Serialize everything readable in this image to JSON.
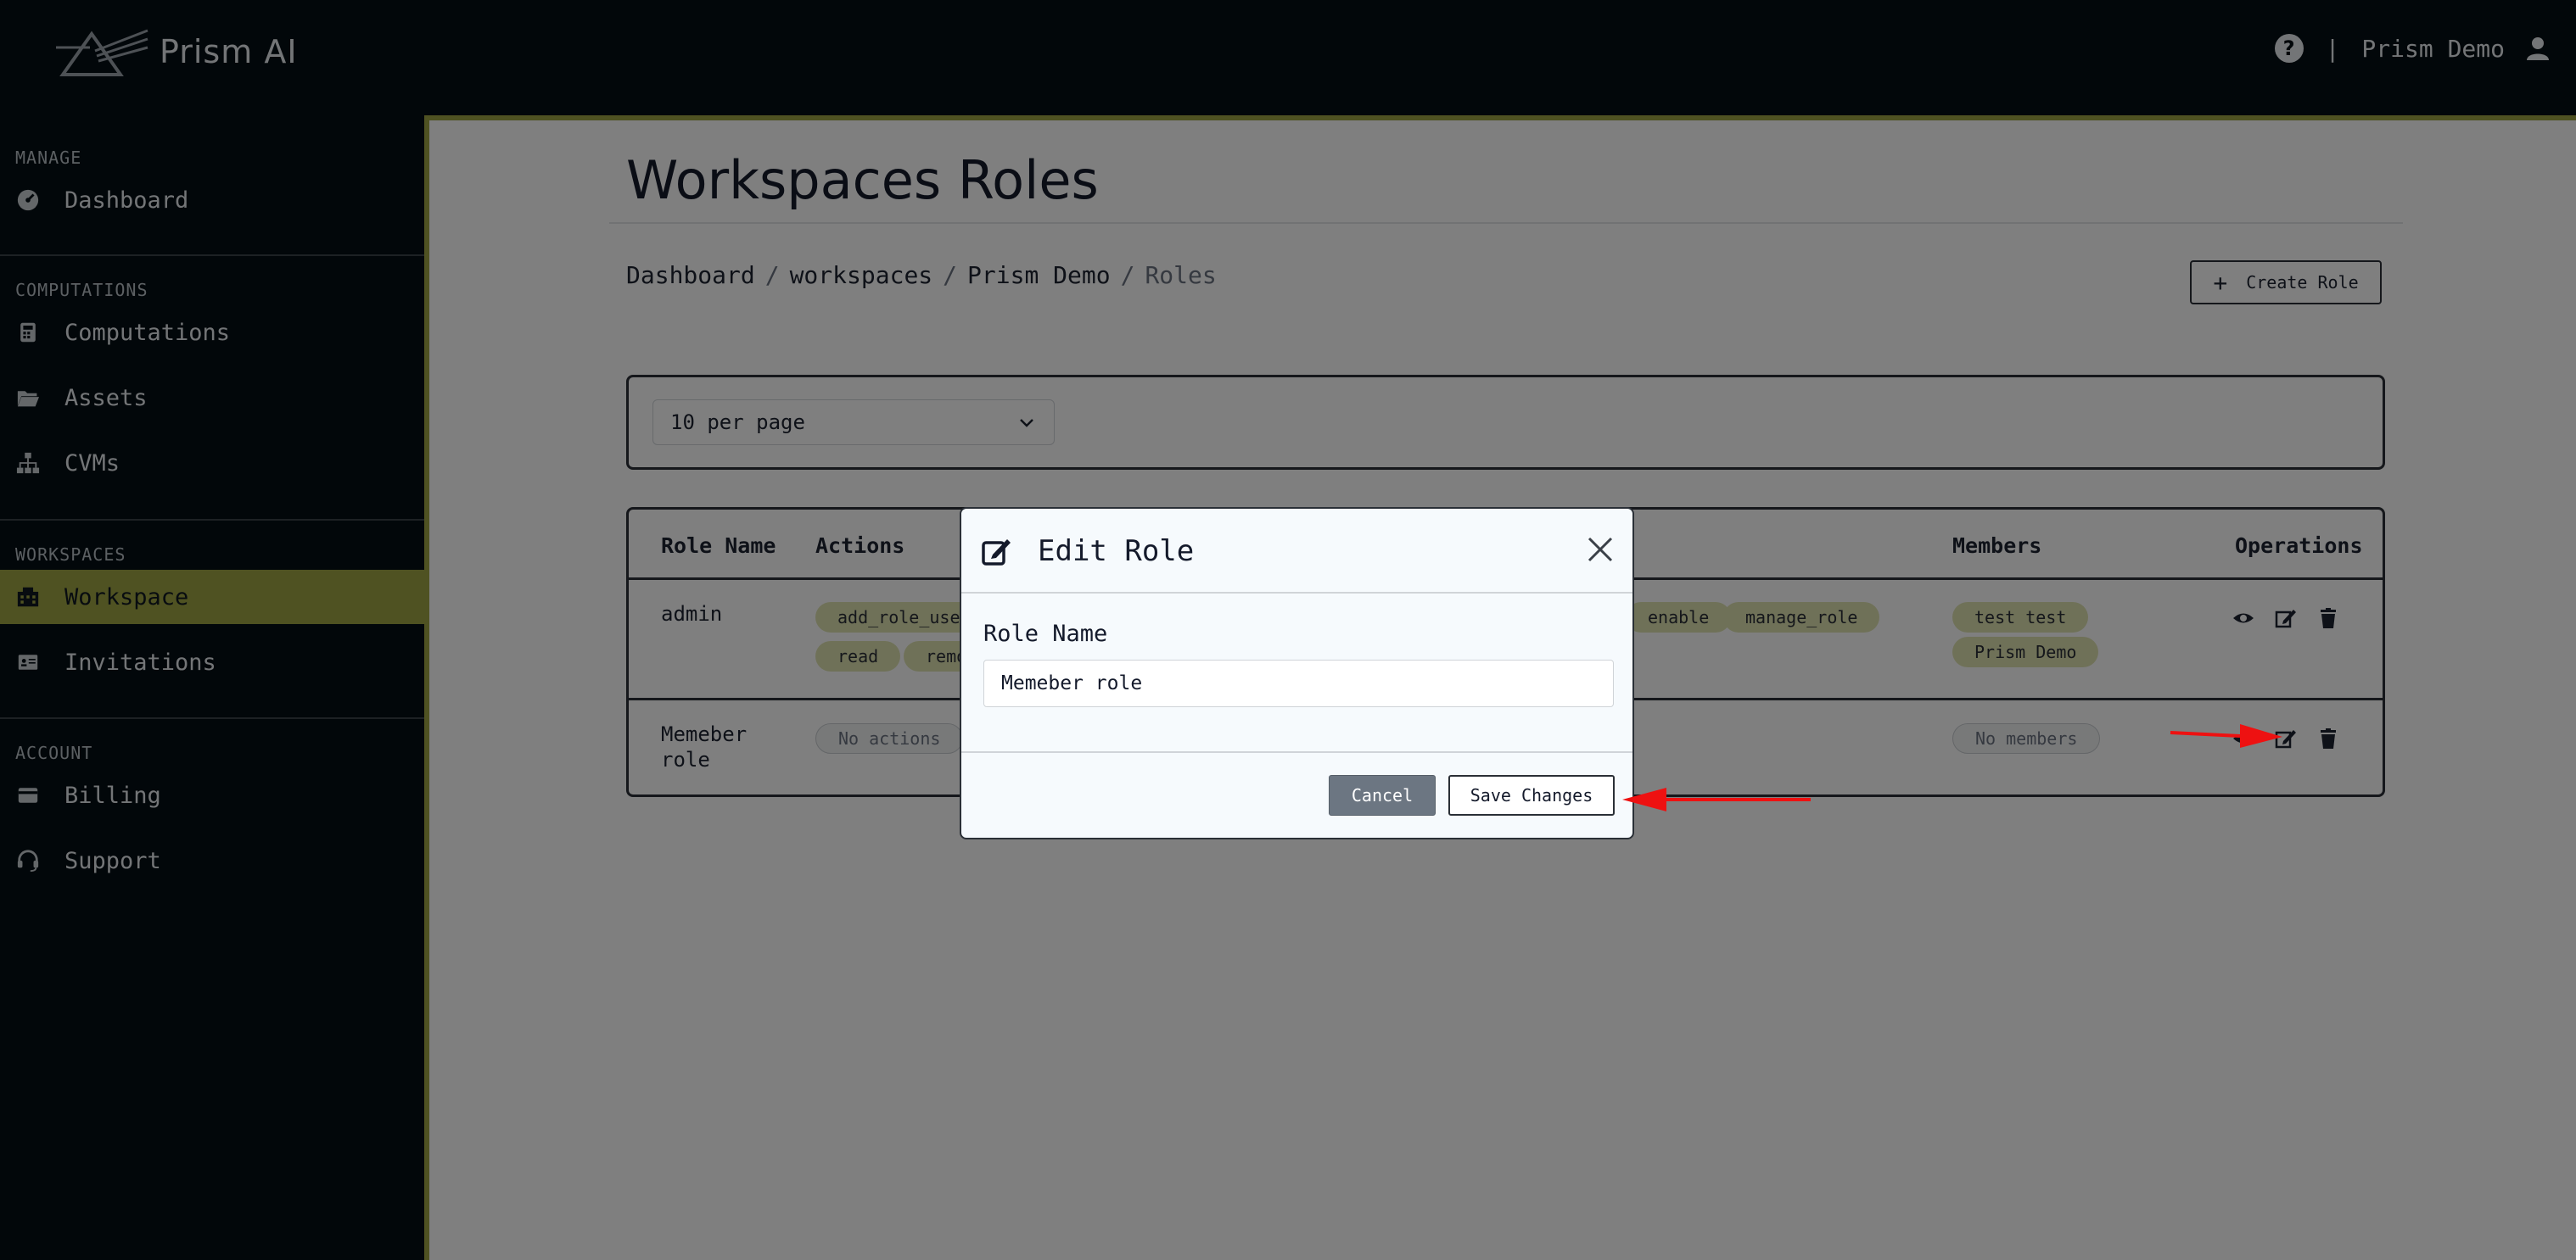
{
  "app": {
    "name": "Prism AI"
  },
  "header": {
    "help_icon": "question-circle-icon",
    "separator": "|",
    "user_name": "Prism Demo"
  },
  "sidebar": {
    "sections": [
      {
        "title": "MANAGE",
        "items": [
          {
            "label": "Dashboard",
            "icon": "dashboard-gauge-icon"
          }
        ]
      },
      {
        "title": "COMPUTATIONS",
        "items": [
          {
            "label": "Computations",
            "icon": "calculator-icon"
          },
          {
            "label": "Assets",
            "icon": "folder-open-icon"
          },
          {
            "label": "CVMs",
            "icon": "sitemap-icon"
          }
        ]
      },
      {
        "title": "WORKSPACES",
        "items": [
          {
            "label": "Workspace",
            "icon": "building-icon",
            "active": true
          },
          {
            "label": "Invitations",
            "icon": "id-card-icon"
          }
        ]
      },
      {
        "title": "ACCOUNT",
        "items": [
          {
            "label": "Billing",
            "icon": "credit-card-icon"
          },
          {
            "label": "Support",
            "icon": "headset-icon"
          }
        ]
      }
    ]
  },
  "page": {
    "title": "Workspaces Roles",
    "breadcrumb": [
      "Dashboard",
      "workspaces",
      "Prism Demo",
      "Roles"
    ],
    "breadcrumb_sep": "/",
    "create_button": "Create Role",
    "per_page": "10 per page"
  },
  "table": {
    "headers": {
      "role_name": "Role Name",
      "actions": "Actions",
      "members": "Members",
      "operations": "Operations"
    },
    "rows": [
      {
        "name": "admin",
        "actions_visible_row1": [
          "add_role_user",
          "enable",
          "manage_role"
        ],
        "actions_visible_row2": [
          "read",
          "remove"
        ],
        "members": [
          "test test",
          "Prism Demo"
        ]
      },
      {
        "name_line1": "Memeber",
        "name_line2": "role",
        "actions_empty": "No actions",
        "members_empty": "No members"
      }
    ]
  },
  "modal": {
    "title": "Edit Role",
    "field_label": "Role Name",
    "field_value": "Memeber role",
    "cancel": "Cancel",
    "save": "Save Changes"
  },
  "colors": {
    "accent": "#9ea545",
    "dark": "#050e14",
    "annotation": "#ee1111"
  }
}
